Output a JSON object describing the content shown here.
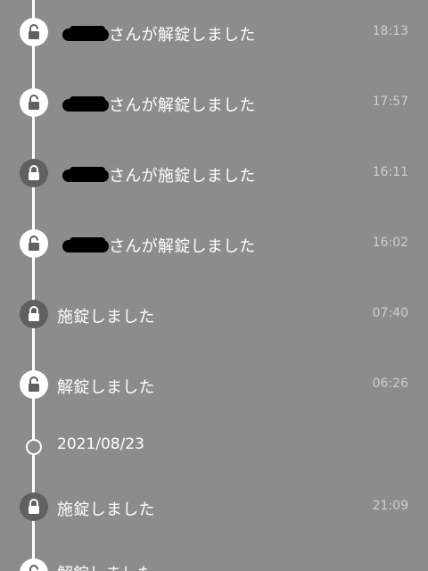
{
  "history": {
    "entries": [
      {
        "message": "さんが解錠しました",
        "time": "18:13",
        "status": "unlocked",
        "icon": "unlocked-padlock-icon"
      },
      {
        "message": "さんが解錠しました",
        "time": "17:57",
        "status": "unlocked",
        "icon": "unlocked-padlock-icon"
      },
      {
        "message": "さんが施錠しました",
        "time": "16:11",
        "status": "locked",
        "icon": "locked-padlock-icon"
      },
      {
        "message": "さんが解錠しました",
        "time": "16:02",
        "status": "unlocked",
        "icon": "unlocked-padlock-icon"
      },
      {
        "message": "施錠しました",
        "time": "07:40",
        "status": "locked",
        "icon": "locked-padlock-icon"
      },
      {
        "message": "解錠しました",
        "time": "06:26",
        "status": "unlocked",
        "icon": "unlocked-padlock-icon"
      }
    ],
    "date_separator": "2021/08/23",
    "later_entries": [
      {
        "message": "施錠しました",
        "time": "21:09",
        "status": "locked",
        "icon": "locked-padlock-icon"
      },
      {
        "message": "解錠しました",
        "status": "unlocked",
        "icon": "unlocked-padlock-icon"
      }
    ]
  },
  "colors": {
    "background": "#8c8c8c",
    "timeline": "#ffffff",
    "locked_node": "#606060",
    "unlocked_node": "#ffffff",
    "time_text": "#cfcfcf"
  }
}
